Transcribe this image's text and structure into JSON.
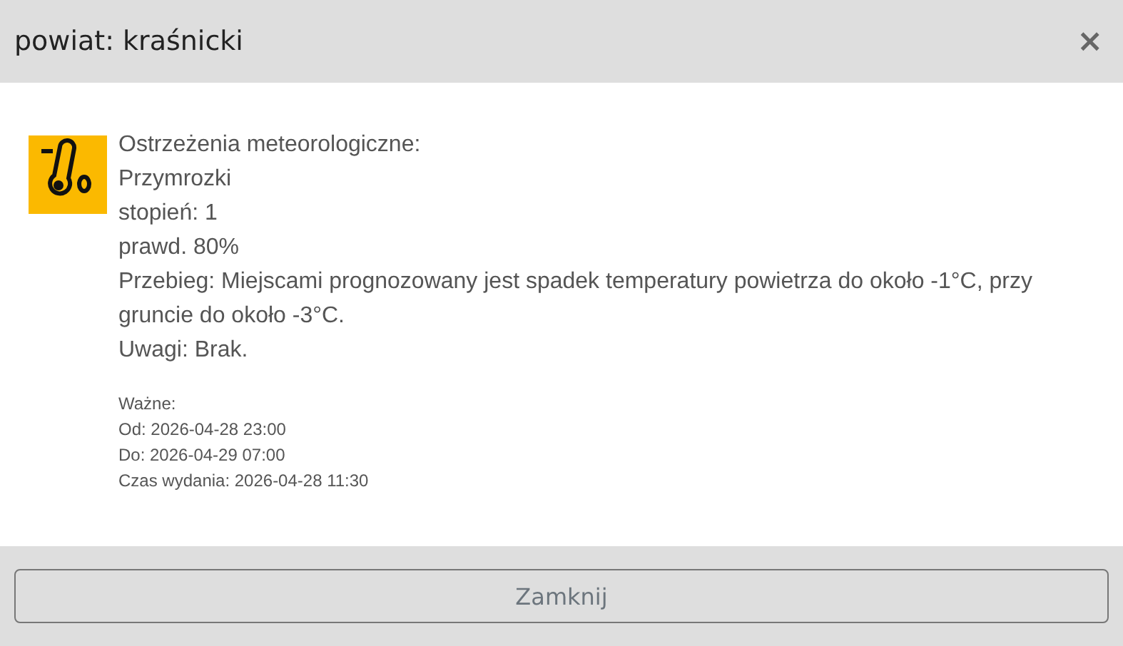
{
  "dialog": {
    "title": "powiat: kraśnicki",
    "close_icon": "×"
  },
  "warning": {
    "heading": "Ostrzeżenia meteorologiczne:",
    "lines": [
      "Przymrozki",
      "stopień: 1",
      "prawd. 80%",
      "Przebieg: Miejscami prognozowany jest spadek temperatury powietrza do około -1°C, przy gruncie do około -3°C.",
      "Uwagi: Brak."
    ],
    "validity": [
      "Ważne:",
      "Od: 2026-04-28 23:00",
      "Do: 2026-04-29 07:00",
      "Czas wydania: 2026-04-28 11:30"
    ]
  },
  "footer": {
    "button": "Zamknij"
  }
}
